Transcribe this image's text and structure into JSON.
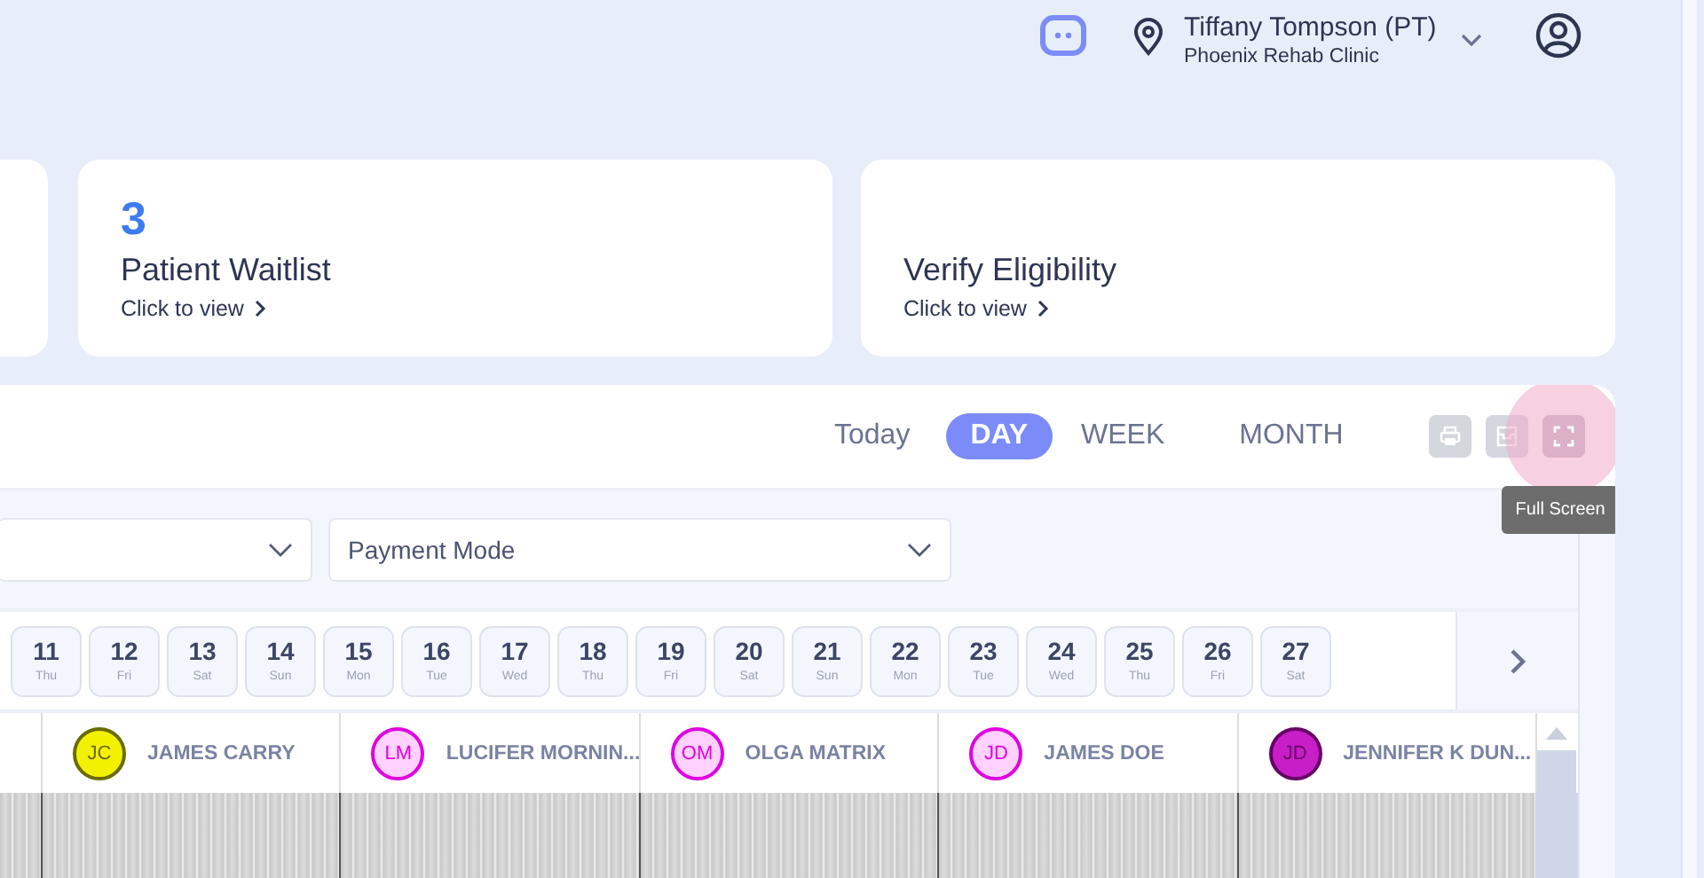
{
  "header": {
    "user_name": "Tiffany Tompson (PT)",
    "clinic": "Phoenix Rehab Clinic"
  },
  "cards": [
    {
      "kind": "blank"
    },
    {
      "kind": "stat",
      "count": "3",
      "title": "Patient Waitlist",
      "link": "Click to view"
    },
    {
      "kind": "stat",
      "title": "Verify Eligibility",
      "link": "Click to view"
    }
  ],
  "calendar": {
    "today": "Today",
    "views": [
      {
        "label": "DAY",
        "selected": true
      },
      {
        "label": "WEEK",
        "selected": false
      },
      {
        "label": "MONTH",
        "selected": false
      }
    ],
    "tools": [
      {
        "kind": "print",
        "hovered": false
      },
      {
        "kind": "archive",
        "hovered": false
      },
      {
        "kind": "fullscreen",
        "hovered": true
      }
    ],
    "tooltip": "Full Screen",
    "filters": [
      {
        "kind": "blank"
      },
      {
        "kind": "text",
        "placeholder": "Payment Mode"
      }
    ],
    "dates": [
      {
        "day": "11",
        "weekday": "Thu"
      },
      {
        "day": "12",
        "weekday": "Fri"
      },
      {
        "day": "13",
        "weekday": "Sat"
      },
      {
        "day": "14",
        "weekday": "Sun"
      },
      {
        "day": "15",
        "weekday": "Mon"
      },
      {
        "day": "16",
        "weekday": "Tue"
      },
      {
        "day": "17",
        "weekday": "Wed"
      },
      {
        "day": "18",
        "weekday": "Thu"
      },
      {
        "day": "19",
        "weekday": "Fri"
      },
      {
        "day": "20",
        "weekday": "Sat"
      },
      {
        "day": "21",
        "weekday": "Sun"
      },
      {
        "day": "22",
        "weekday": "Mon"
      },
      {
        "day": "23",
        "weekday": "Tue"
      },
      {
        "day": "24",
        "weekday": "Wed"
      },
      {
        "day": "25",
        "weekday": "Thu"
      },
      {
        "day": "26",
        "weekday": "Fri"
      },
      {
        "day": "27",
        "weekday": "Sat"
      }
    ],
    "providers": [
      {
        "initials": "JC",
        "name": "JAMES CARRY",
        "color": "#f2f200"
      },
      {
        "initials": "LM",
        "name": "LUCIFER MORNIN...",
        "color": "#ffd2ff"
      },
      {
        "initials": "OM",
        "name": "OLGA MATRIX",
        "color": "#ffd2ff"
      },
      {
        "initials": "JD",
        "name": "JAMES DOE",
        "color": "#ffd2ff"
      },
      {
        "initials": "JD",
        "name": "JENNIFER K DUN...",
        "color": "#c81ec8"
      }
    ]
  }
}
